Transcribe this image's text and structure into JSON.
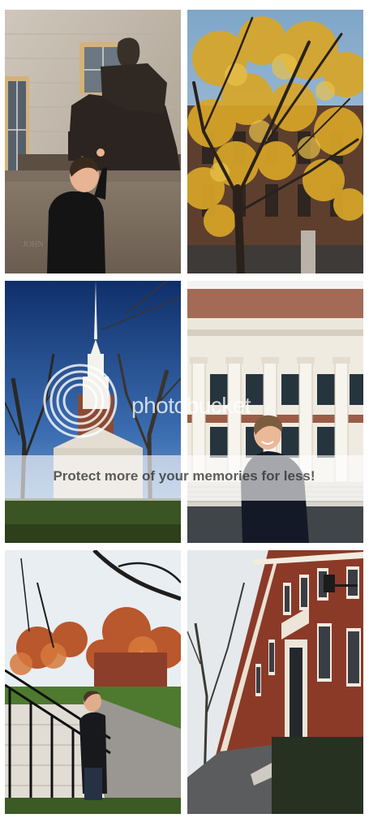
{
  "watermark": {
    "brand": "photobucket",
    "tagline": "Protect more of your memories for less!"
  },
  "photos": [
    {
      "subject": "boy-with-seated-statue"
    },
    {
      "subject": "yellow-autumn-tree"
    },
    {
      "subject": "white-church-steeple"
    },
    {
      "subject": "boy-before-columned-library"
    },
    {
      "subject": "boy-on-railing-autumn-yard"
    },
    {
      "subject": "brick-building-row"
    }
  ]
}
